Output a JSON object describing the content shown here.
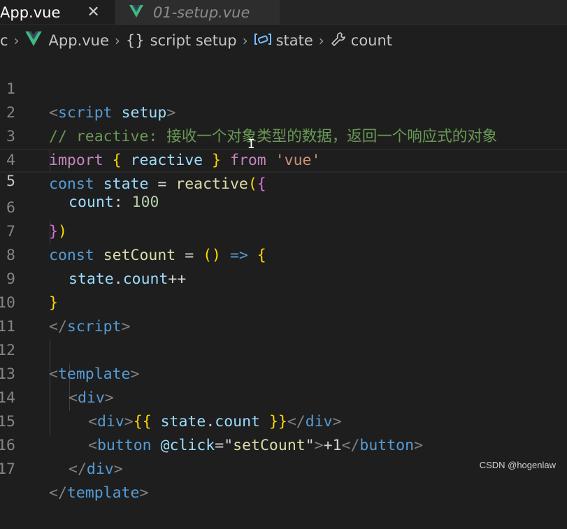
{
  "tabs": [
    {
      "label": "App.vue",
      "close": "✕"
    },
    {
      "label": "01-setup.vue"
    }
  ],
  "breadcrumb": {
    "lead": "c",
    "file": "App.vue",
    "section": "script setup",
    "object": "state",
    "property": "count"
  },
  "colors": {
    "vue_green": "#41b883",
    "vue_dark": "#35495e"
  },
  "editor": {
    "current_line": 5,
    "line_numbers": [
      "1",
      "2",
      "3",
      "4",
      "5",
      "6",
      "7",
      "8",
      "9",
      "10",
      "11",
      "12",
      "13",
      "14",
      "15",
      "16",
      "17"
    ],
    "code": {
      "l1": {
        "open": "<",
        "tag": "script",
        "attr": "setup",
        "close": ">"
      },
      "l2": {
        "comment": "// reactive: 接收一个对象类型的数据，返回一个响应式的对象"
      },
      "l3": {
        "kw": "import",
        "b_open": "{",
        "name": "reactive",
        "b_close": "}",
        "from": "from",
        "str": "'vue'"
      },
      "l4": {
        "kw": "const",
        "name": "state",
        "eq": "=",
        "fn": "reactive",
        "p_open": "(",
        "b_open": "{"
      },
      "l5": {
        "prop": "count",
        "colon": ":",
        "num": "100"
      },
      "l6": {
        "b_close": "}",
        "p_close": ")"
      },
      "l7": {
        "kw": "const",
        "name": "setCount",
        "eq": "=",
        "parens": "()",
        "arrow": "=>",
        "b_open": "{"
      },
      "l8": {
        "obj": "state",
        "dot": ".",
        "prop": "count",
        "op": "++"
      },
      "l9": {
        "b_close": "}"
      },
      "l10": {
        "open": "</",
        "tag": "script",
        "close": ">"
      },
      "l12": {
        "open": "<",
        "tag": "template",
        "close": ">"
      },
      "l13": {
        "open": "<",
        "tag": "div",
        "close": ">"
      },
      "l14": {
        "open": "<",
        "tag": "div",
        "close": ">",
        "m_open": "{{",
        "obj": "state",
        "dot": ".",
        "prop": "count",
        "m_close": "}}",
        "end_open": "</",
        "end_tag": "div",
        "end_close": ">"
      },
      "l15": {
        "open": "<",
        "tag": "button",
        "attr": "@click",
        "eq": "=",
        "q1": "\"",
        "val": "setCount",
        "q2": "\"",
        "close": ">",
        "text": "+1",
        "end_open": "</",
        "end_tag": "button",
        "end_close": ">"
      },
      "l16": {
        "open": "</",
        "tag": "div",
        "close": ">"
      },
      "l17": {
        "open": "</",
        "tag": "template",
        "close": ">"
      }
    }
  },
  "watermark": "CSDN @hogenlaw"
}
